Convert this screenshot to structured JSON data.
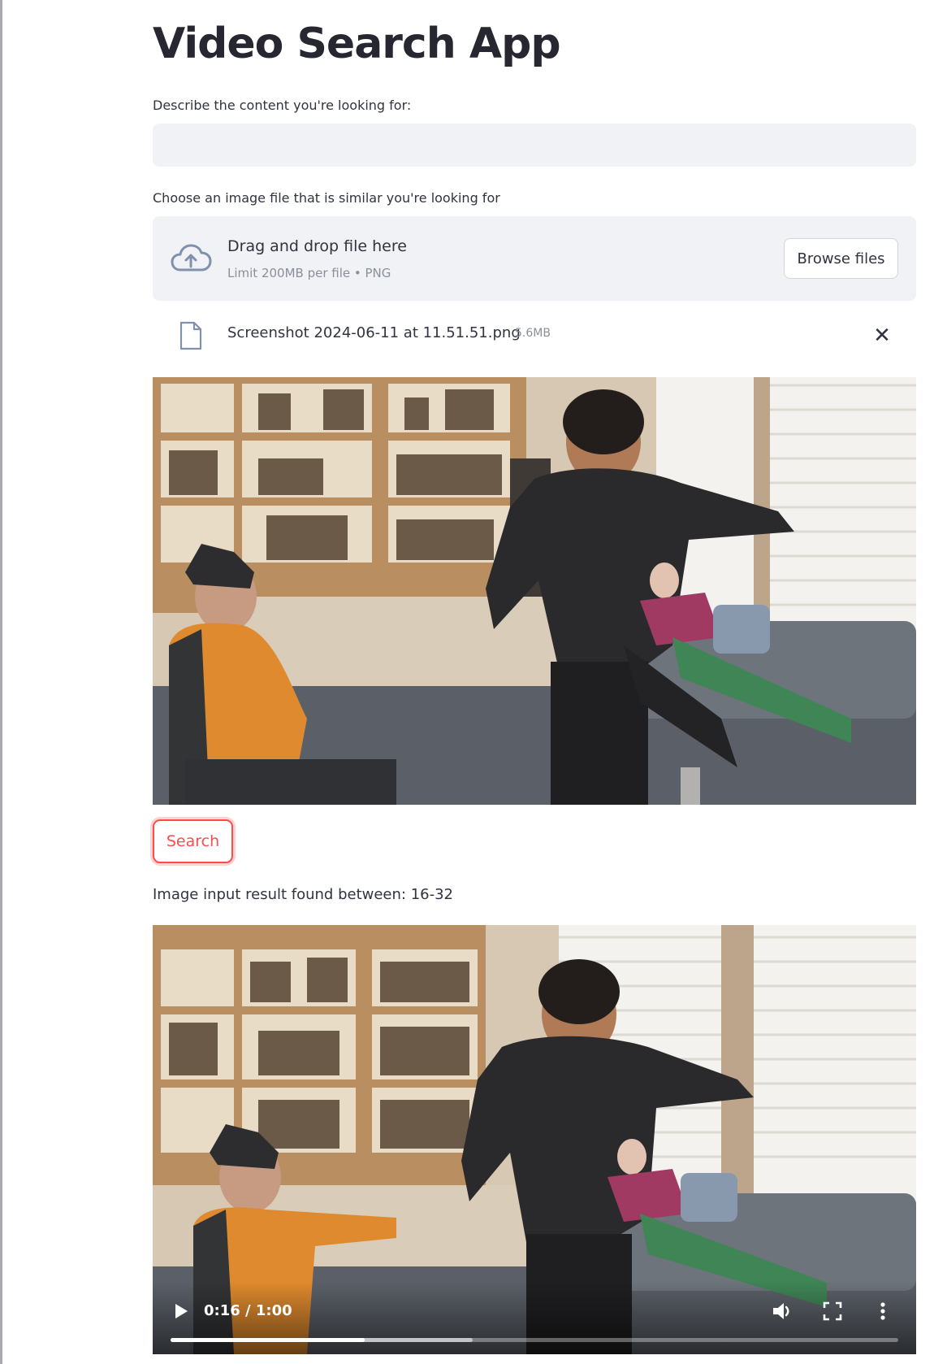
{
  "app": {
    "title": "Video Search App"
  },
  "text_search": {
    "label": "Describe the content you're looking for:",
    "value": "",
    "placeholder": ""
  },
  "uploader": {
    "label": "Choose an image file that is similar you're looking for",
    "drop_title": "Drag and drop file here",
    "drop_subtitle": "Limit 200MB per file • PNG",
    "browse_label": "Browse files",
    "file": {
      "name": "Screenshot 2024-06-11 at 11.51.51.png",
      "size": "5.6MB"
    },
    "remove_symbol": "✕"
  },
  "search_button": {
    "label": "Search"
  },
  "result": {
    "text": "Image input result found between: 16-32"
  },
  "video": {
    "time": "0:16 / 1:00",
    "progress_fraction": 0.267,
    "buffered_fraction": 0.415
  },
  "colors": {
    "accent": "#ff4b4b",
    "input_bg": "#f0f2f6",
    "text": "#31333f",
    "muted": "#8b8f99"
  },
  "icons": {
    "upload": "cloud-upload-icon",
    "file": "file-icon",
    "remove": "close-icon",
    "play": "play-icon",
    "volume": "volume-icon",
    "fullscreen": "fullscreen-icon",
    "more": "more-vertical-icon"
  }
}
